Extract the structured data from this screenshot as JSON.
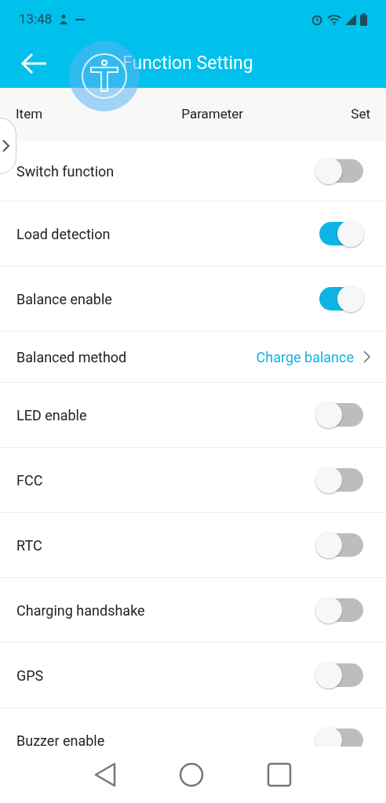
{
  "status_bar": {
    "time": "13:48"
  },
  "header": {
    "title": "Function Setting"
  },
  "columns": [
    "Item",
    "Parameter",
    "Set"
  ],
  "rows": [
    {
      "kind": "toggle",
      "label": "Switch function",
      "on": false
    },
    {
      "kind": "toggle",
      "label": "Load detection",
      "on": true
    },
    {
      "kind": "toggle",
      "label": "Balance enable",
      "on": true
    },
    {
      "kind": "select",
      "label": "Balanced method",
      "value": "Charge balance"
    },
    {
      "kind": "toggle",
      "label": "LED enable",
      "on": false
    },
    {
      "kind": "toggle",
      "label": "FCC",
      "on": false
    },
    {
      "kind": "toggle",
      "label": "RTC",
      "on": false
    },
    {
      "kind": "toggle",
      "label": "Charging handshake",
      "on": false
    },
    {
      "kind": "toggle",
      "label": "GPS",
      "on": false
    },
    {
      "kind": "toggle",
      "label": "Buzzer enable",
      "on": false
    }
  ]
}
